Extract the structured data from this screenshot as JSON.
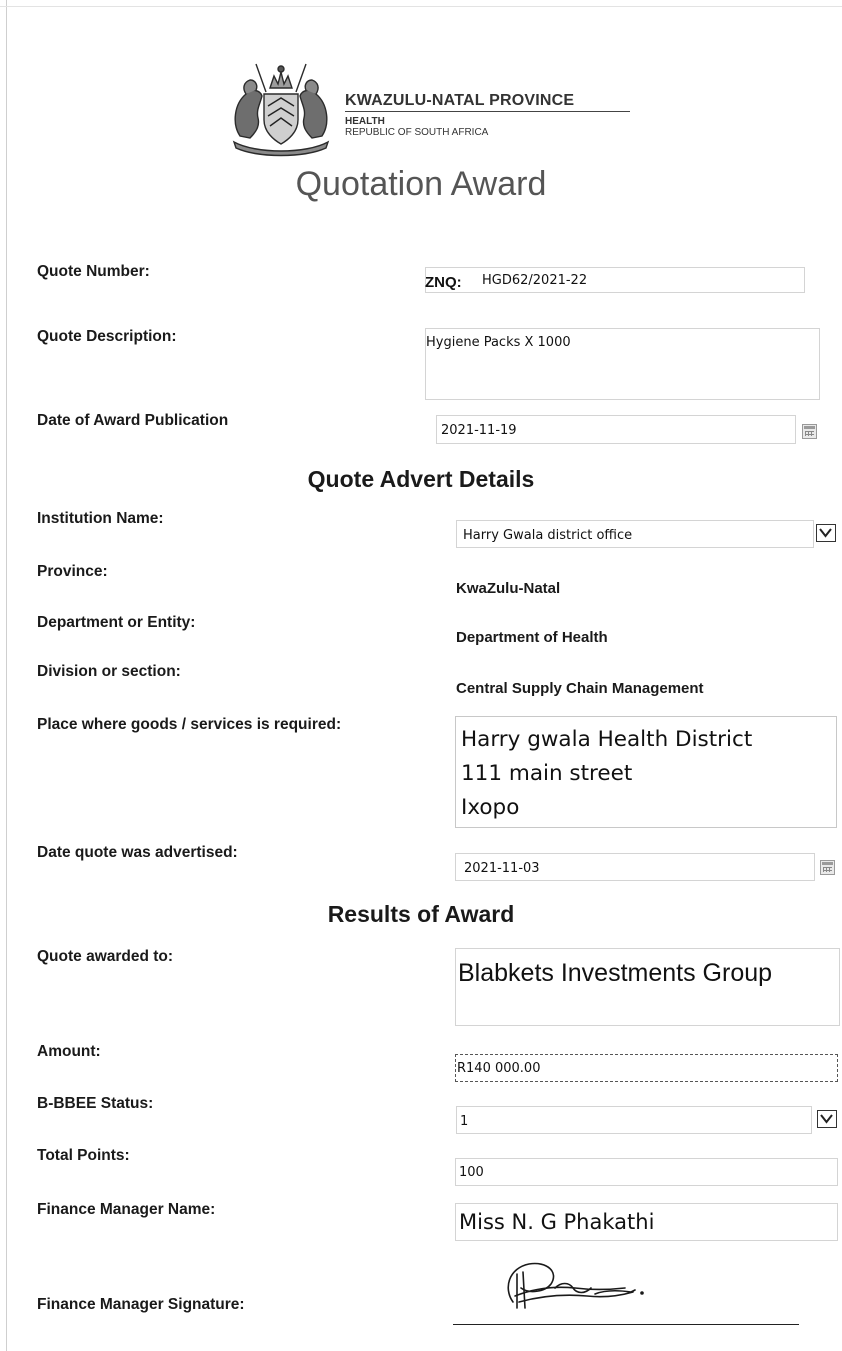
{
  "header": {
    "province": "KWAZULU-NATAL PROVINCE",
    "department": "HEALTH",
    "country": "REPUBLIC OF SOUTH AFRICA",
    "title": "Quotation Award"
  },
  "quote": {
    "number_label": "Quote Number:",
    "number_prefix": "ZNQ:",
    "number_value": "HGD62/2021-22",
    "description_label": "Quote Description:",
    "description_value": "Hygiene Packs X 1000",
    "award_date_label": "Date of Award Publication",
    "award_date_value": "2021-11-19"
  },
  "advert": {
    "heading": "Quote Advert Details",
    "institution_label": "Institution Name:",
    "institution_value": "Harry Gwala district office",
    "province_label": "Province:",
    "province_value": "KwaZulu-Natal",
    "department_label": "Department or Entity:",
    "department_value": "Department of Health",
    "division_label": "Division or section:",
    "division_value": "Central Supply Chain Management",
    "place_label": "Place where goods /  services is required:",
    "place_lines": [
      "Harry gwala Health District",
      "111 main street",
      "Ixopo"
    ],
    "advertised_label": "Date quote was advertised:",
    "advertised_value": "2021-11-03"
  },
  "results": {
    "heading": "Results of Award",
    "awarded_label": "Quote awarded to:",
    "awarded_value": "Blabkets Investments Group",
    "amount_label": "Amount:",
    "amount_value": "R140 000.00",
    "bbbee_label": "B-BBEE Status:",
    "bbbee_value": "1",
    "points_label": "Total Points:",
    "points_value": "100",
    "fm_name_label": "Finance Manager Name:",
    "fm_name_value": "Miss N. G Phakathi",
    "fm_signature_label": "Finance Manager Signature:"
  },
  "icons": {
    "crest": "coat-of-arms-icon",
    "dropdown": "chevron-down-icon",
    "calendar": "calendar-icon"
  }
}
